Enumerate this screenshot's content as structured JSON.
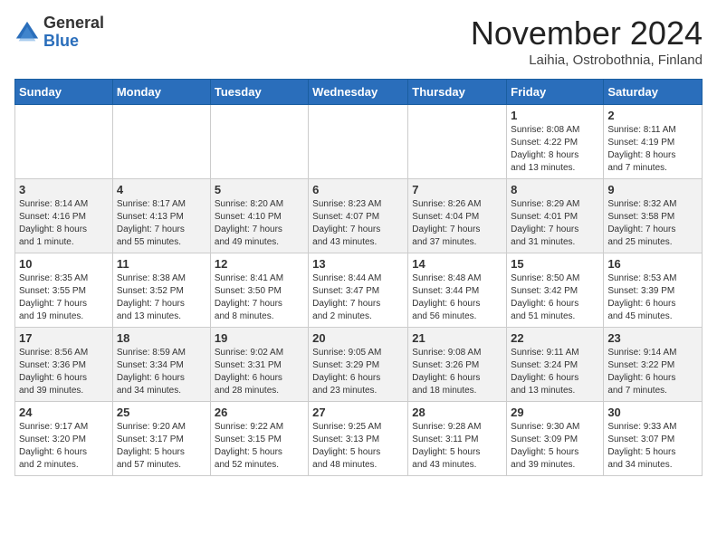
{
  "logo": {
    "general": "General",
    "blue": "Blue"
  },
  "header": {
    "month": "November 2024",
    "location": "Laihia, Ostrobothnia, Finland"
  },
  "days_of_week": [
    "Sunday",
    "Monday",
    "Tuesday",
    "Wednesday",
    "Thursday",
    "Friday",
    "Saturday"
  ],
  "weeks": [
    [
      {
        "day": "",
        "info": ""
      },
      {
        "day": "",
        "info": ""
      },
      {
        "day": "",
        "info": ""
      },
      {
        "day": "",
        "info": ""
      },
      {
        "day": "",
        "info": ""
      },
      {
        "day": "1",
        "info": "Sunrise: 8:08 AM\nSunset: 4:22 PM\nDaylight: 8 hours\nand 13 minutes."
      },
      {
        "day": "2",
        "info": "Sunrise: 8:11 AM\nSunset: 4:19 PM\nDaylight: 8 hours\nand 7 minutes."
      }
    ],
    [
      {
        "day": "3",
        "info": "Sunrise: 8:14 AM\nSunset: 4:16 PM\nDaylight: 8 hours\nand 1 minute."
      },
      {
        "day": "4",
        "info": "Sunrise: 8:17 AM\nSunset: 4:13 PM\nDaylight: 7 hours\nand 55 minutes."
      },
      {
        "day": "5",
        "info": "Sunrise: 8:20 AM\nSunset: 4:10 PM\nDaylight: 7 hours\nand 49 minutes."
      },
      {
        "day": "6",
        "info": "Sunrise: 8:23 AM\nSunset: 4:07 PM\nDaylight: 7 hours\nand 43 minutes."
      },
      {
        "day": "7",
        "info": "Sunrise: 8:26 AM\nSunset: 4:04 PM\nDaylight: 7 hours\nand 37 minutes."
      },
      {
        "day": "8",
        "info": "Sunrise: 8:29 AM\nSunset: 4:01 PM\nDaylight: 7 hours\nand 31 minutes."
      },
      {
        "day": "9",
        "info": "Sunrise: 8:32 AM\nSunset: 3:58 PM\nDaylight: 7 hours\nand 25 minutes."
      }
    ],
    [
      {
        "day": "10",
        "info": "Sunrise: 8:35 AM\nSunset: 3:55 PM\nDaylight: 7 hours\nand 19 minutes."
      },
      {
        "day": "11",
        "info": "Sunrise: 8:38 AM\nSunset: 3:52 PM\nDaylight: 7 hours\nand 13 minutes."
      },
      {
        "day": "12",
        "info": "Sunrise: 8:41 AM\nSunset: 3:50 PM\nDaylight: 7 hours\nand 8 minutes."
      },
      {
        "day": "13",
        "info": "Sunrise: 8:44 AM\nSunset: 3:47 PM\nDaylight: 7 hours\nand 2 minutes."
      },
      {
        "day": "14",
        "info": "Sunrise: 8:48 AM\nSunset: 3:44 PM\nDaylight: 6 hours\nand 56 minutes."
      },
      {
        "day": "15",
        "info": "Sunrise: 8:50 AM\nSunset: 3:42 PM\nDaylight: 6 hours\nand 51 minutes."
      },
      {
        "day": "16",
        "info": "Sunrise: 8:53 AM\nSunset: 3:39 PM\nDaylight: 6 hours\nand 45 minutes."
      }
    ],
    [
      {
        "day": "17",
        "info": "Sunrise: 8:56 AM\nSunset: 3:36 PM\nDaylight: 6 hours\nand 39 minutes."
      },
      {
        "day": "18",
        "info": "Sunrise: 8:59 AM\nSunset: 3:34 PM\nDaylight: 6 hours\nand 34 minutes."
      },
      {
        "day": "19",
        "info": "Sunrise: 9:02 AM\nSunset: 3:31 PM\nDaylight: 6 hours\nand 28 minutes."
      },
      {
        "day": "20",
        "info": "Sunrise: 9:05 AM\nSunset: 3:29 PM\nDaylight: 6 hours\nand 23 minutes."
      },
      {
        "day": "21",
        "info": "Sunrise: 9:08 AM\nSunset: 3:26 PM\nDaylight: 6 hours\nand 18 minutes."
      },
      {
        "day": "22",
        "info": "Sunrise: 9:11 AM\nSunset: 3:24 PM\nDaylight: 6 hours\nand 13 minutes."
      },
      {
        "day": "23",
        "info": "Sunrise: 9:14 AM\nSunset: 3:22 PM\nDaylight: 6 hours\nand 7 minutes."
      }
    ],
    [
      {
        "day": "24",
        "info": "Sunrise: 9:17 AM\nSunset: 3:20 PM\nDaylight: 6 hours\nand 2 minutes."
      },
      {
        "day": "25",
        "info": "Sunrise: 9:20 AM\nSunset: 3:17 PM\nDaylight: 5 hours\nand 57 minutes."
      },
      {
        "day": "26",
        "info": "Sunrise: 9:22 AM\nSunset: 3:15 PM\nDaylight: 5 hours\nand 52 minutes."
      },
      {
        "day": "27",
        "info": "Sunrise: 9:25 AM\nSunset: 3:13 PM\nDaylight: 5 hours\nand 48 minutes."
      },
      {
        "day": "28",
        "info": "Sunrise: 9:28 AM\nSunset: 3:11 PM\nDaylight: 5 hours\nand 43 minutes."
      },
      {
        "day": "29",
        "info": "Sunrise: 9:30 AM\nSunset: 3:09 PM\nDaylight: 5 hours\nand 39 minutes."
      },
      {
        "day": "30",
        "info": "Sunrise: 9:33 AM\nSunset: 3:07 PM\nDaylight: 5 hours\nand 34 minutes."
      }
    ]
  ]
}
